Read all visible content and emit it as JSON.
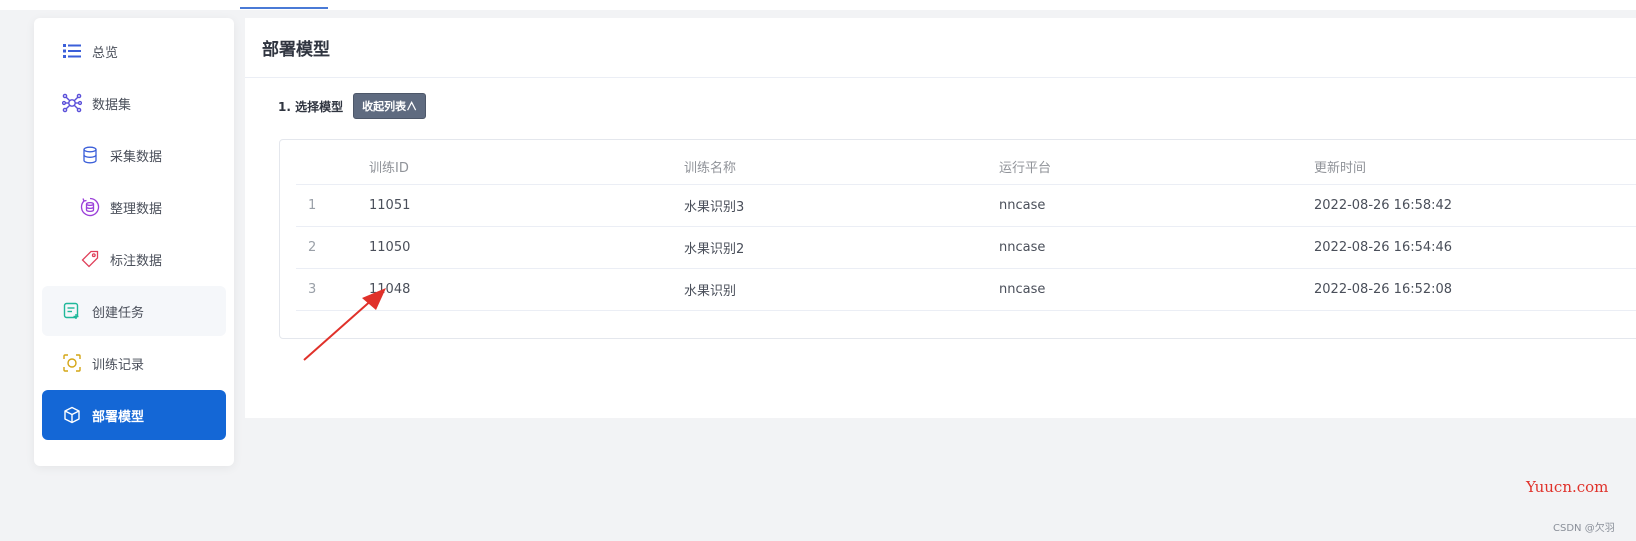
{
  "sidebar": {
    "items": [
      {
        "label": "总览",
        "icon": "list-icon"
      },
      {
        "label": "数据集",
        "icon": "network-icon"
      },
      {
        "label": "采集数据",
        "icon": "database-icon"
      },
      {
        "label": "整理数据",
        "icon": "database-refresh-icon"
      },
      {
        "label": "标注数据",
        "icon": "tag-icon"
      },
      {
        "label": "创建任务",
        "icon": "task-add-icon"
      },
      {
        "label": "训练记录",
        "icon": "training-record-icon"
      },
      {
        "label": "部署模型",
        "icon": "cube-icon"
      }
    ],
    "active": "部署模型"
  },
  "main": {
    "title": "部署模型",
    "step_label": "1. 选择模型",
    "collapse_label": "收起列表∧",
    "table": {
      "headers": [
        "",
        "训练ID",
        "训练名称",
        "运行平台",
        "更新时间"
      ],
      "rows": [
        {
          "index": "1",
          "id": "11051",
          "name": "水果识别3",
          "platform": "nncase",
          "updated": "2022-08-26 16:58:42"
        },
        {
          "index": "2",
          "id": "11050",
          "name": "水果识别2",
          "platform": "nncase",
          "updated": "2022-08-26 16:54:46"
        },
        {
          "index": "3",
          "id": "11048",
          "name": "水果识别",
          "platform": "nncase",
          "updated": "2022-08-26 16:52:08"
        }
      ]
    }
  },
  "watermark": "Yuucn.com",
  "credit": "CSDN @欠羽",
  "colors": {
    "accent": "#1467d6",
    "annotation_arrow": "#e0312a"
  }
}
